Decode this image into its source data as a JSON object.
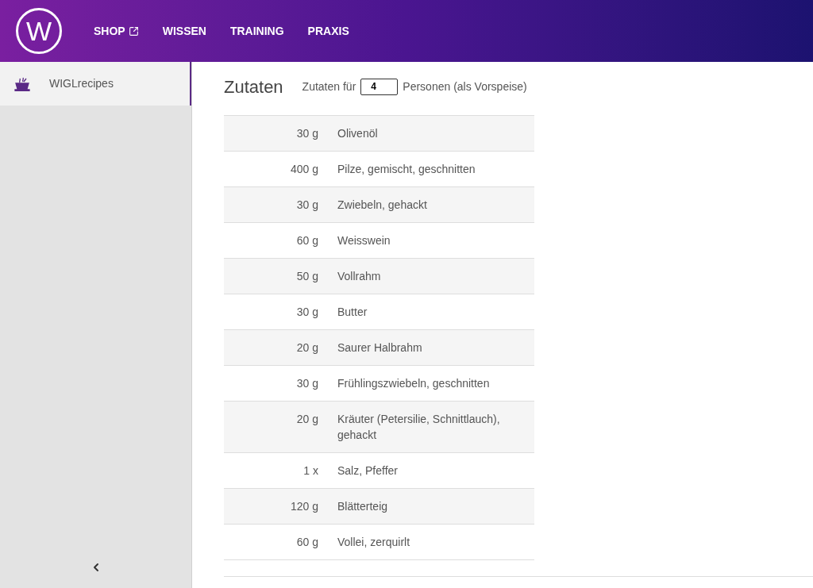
{
  "header": {
    "logo": "W",
    "nav": [
      {
        "label": "SHOP",
        "external": true
      },
      {
        "label": "WISSEN",
        "external": false
      },
      {
        "label": "TRAINING",
        "external": false
      },
      {
        "label": "PRAXIS",
        "external": false
      }
    ]
  },
  "sidebar": {
    "items": [
      {
        "label": "WIGLrecipes",
        "selected": true
      }
    ]
  },
  "ingredients": {
    "title": "Zutaten",
    "servings_label": "Zutaten für",
    "servings": "4",
    "servings_suffix": "Personen (als Vorspeise)",
    "rows": [
      {
        "amount": "30 g",
        "name": "Olivenöl"
      },
      {
        "amount": "400 g",
        "name": "Pilze, gemischt, geschnitten"
      },
      {
        "amount": "30 g",
        "name": "Zwiebeln, gehackt"
      },
      {
        "amount": "60 g",
        "name": "Weisswein"
      },
      {
        "amount": "50 g",
        "name": "Vollrahm"
      },
      {
        "amount": "30 g",
        "name": "Butter"
      },
      {
        "amount": "20 g",
        "name": "Saurer Halbrahm"
      },
      {
        "amount": "30 g",
        "name": "Frühlingszwiebeln, geschnitten"
      },
      {
        "amount": "20 g",
        "name": "Kräuter (Petersilie, Schnittlauch), gehackt"
      },
      {
        "amount": "1 x",
        "name": "Salz, Pfeffer"
      },
      {
        "amount": "120 g",
        "name": "Blätterteig"
      },
      {
        "amount": "60 g",
        "name": "Vollei, zerquirlt"
      }
    ]
  }
}
